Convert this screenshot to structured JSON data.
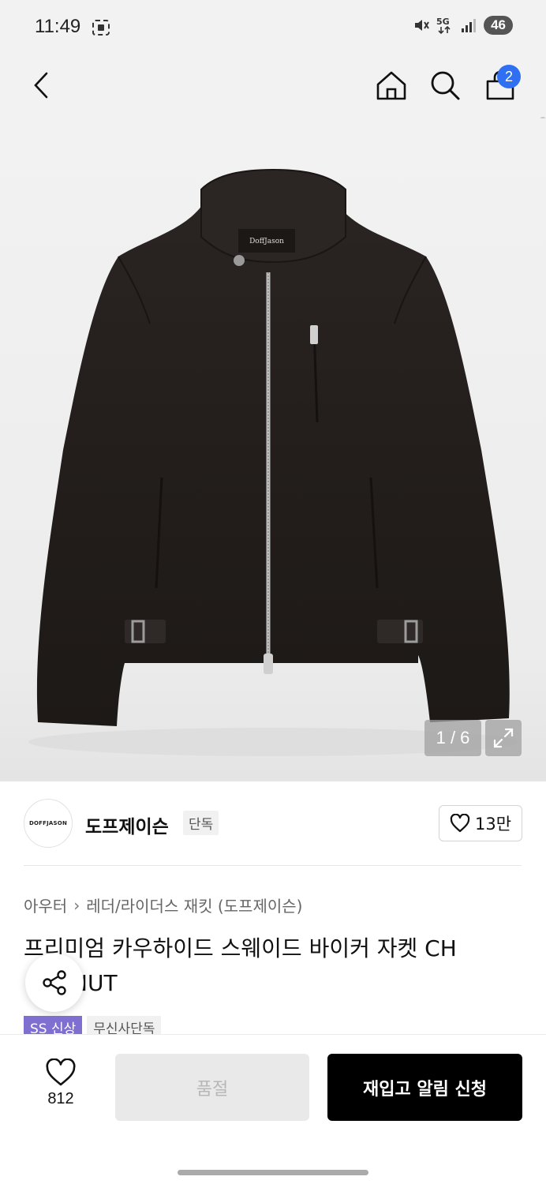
{
  "status_bar": {
    "time": "11:49",
    "battery": "46",
    "icons": [
      "screen-record-icon",
      "mute-icon",
      "5g-icon",
      "signal-icon",
      "battery-icon"
    ]
  },
  "nav": {
    "icons": [
      "back-icon",
      "home-icon",
      "search-icon",
      "cart-icon"
    ],
    "cart_count": "2"
  },
  "gallery": {
    "counter": "1 / 6",
    "image_alt": "dark brown suede biker jacket",
    "label_text": "DoffJason"
  },
  "brand": {
    "logo_text": "DOFFJASON",
    "name": "도프제이슨",
    "exclusive_badge": "단독",
    "likes": "13만"
  },
  "breadcrumb": {
    "items": [
      "아우터",
      "레더/라이더스 재킷 (도프제이슨)"
    ]
  },
  "product": {
    "title_line1": "프리미엄 카우하이드 스웨이드 바이커 자켓 CH",
    "title_line2": "NUT"
  },
  "tags": {
    "new_label": "SS 신상",
    "exclusive_label": "무신사단독"
  },
  "bottom": {
    "favorite_count": "812",
    "soldout_label": "품절",
    "restock_label": "재입고 알림 신청"
  },
  "colors": {
    "accent_blue": "#2f6ff2",
    "tag_purple": "#7e6fd1",
    "button_black": "#000000"
  }
}
